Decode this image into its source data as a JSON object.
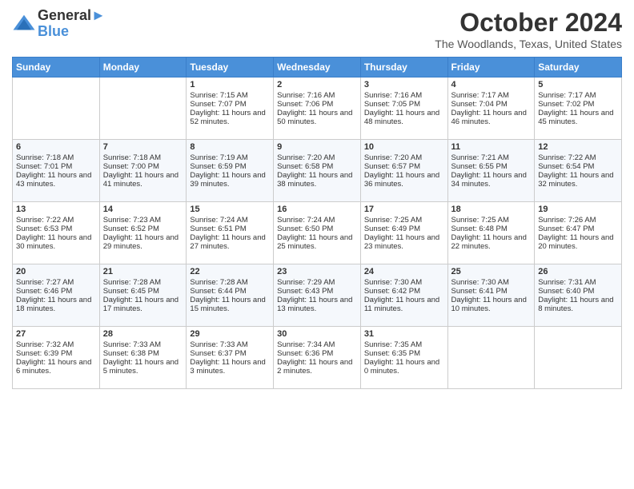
{
  "header": {
    "logo_line1": "General",
    "logo_line2": "Blue",
    "month": "October 2024",
    "location": "The Woodlands, Texas, United States"
  },
  "weekdays": [
    "Sunday",
    "Monday",
    "Tuesday",
    "Wednesday",
    "Thursday",
    "Friday",
    "Saturday"
  ],
  "weeks": [
    [
      {
        "num": "",
        "empty": true
      },
      {
        "num": "",
        "empty": true
      },
      {
        "num": "1",
        "sunrise": "Sunrise: 7:15 AM",
        "sunset": "Sunset: 7:07 PM",
        "daylight": "Daylight: 11 hours and 52 minutes."
      },
      {
        "num": "2",
        "sunrise": "Sunrise: 7:16 AM",
        "sunset": "Sunset: 7:06 PM",
        "daylight": "Daylight: 11 hours and 50 minutes."
      },
      {
        "num": "3",
        "sunrise": "Sunrise: 7:16 AM",
        "sunset": "Sunset: 7:05 PM",
        "daylight": "Daylight: 11 hours and 48 minutes."
      },
      {
        "num": "4",
        "sunrise": "Sunrise: 7:17 AM",
        "sunset": "Sunset: 7:04 PM",
        "daylight": "Daylight: 11 hours and 46 minutes."
      },
      {
        "num": "5",
        "sunrise": "Sunrise: 7:17 AM",
        "sunset": "Sunset: 7:02 PM",
        "daylight": "Daylight: 11 hours and 45 minutes."
      }
    ],
    [
      {
        "num": "6",
        "sunrise": "Sunrise: 7:18 AM",
        "sunset": "Sunset: 7:01 PM",
        "daylight": "Daylight: 11 hours and 43 minutes."
      },
      {
        "num": "7",
        "sunrise": "Sunrise: 7:18 AM",
        "sunset": "Sunset: 7:00 PM",
        "daylight": "Daylight: 11 hours and 41 minutes."
      },
      {
        "num": "8",
        "sunrise": "Sunrise: 7:19 AM",
        "sunset": "Sunset: 6:59 PM",
        "daylight": "Daylight: 11 hours and 39 minutes."
      },
      {
        "num": "9",
        "sunrise": "Sunrise: 7:20 AM",
        "sunset": "Sunset: 6:58 PM",
        "daylight": "Daylight: 11 hours and 38 minutes."
      },
      {
        "num": "10",
        "sunrise": "Sunrise: 7:20 AM",
        "sunset": "Sunset: 6:57 PM",
        "daylight": "Daylight: 11 hours and 36 minutes."
      },
      {
        "num": "11",
        "sunrise": "Sunrise: 7:21 AM",
        "sunset": "Sunset: 6:55 PM",
        "daylight": "Daylight: 11 hours and 34 minutes."
      },
      {
        "num": "12",
        "sunrise": "Sunrise: 7:22 AM",
        "sunset": "Sunset: 6:54 PM",
        "daylight": "Daylight: 11 hours and 32 minutes."
      }
    ],
    [
      {
        "num": "13",
        "sunrise": "Sunrise: 7:22 AM",
        "sunset": "Sunset: 6:53 PM",
        "daylight": "Daylight: 11 hours and 30 minutes."
      },
      {
        "num": "14",
        "sunrise": "Sunrise: 7:23 AM",
        "sunset": "Sunset: 6:52 PM",
        "daylight": "Daylight: 11 hours and 29 minutes."
      },
      {
        "num": "15",
        "sunrise": "Sunrise: 7:24 AM",
        "sunset": "Sunset: 6:51 PM",
        "daylight": "Daylight: 11 hours and 27 minutes."
      },
      {
        "num": "16",
        "sunrise": "Sunrise: 7:24 AM",
        "sunset": "Sunset: 6:50 PM",
        "daylight": "Daylight: 11 hours and 25 minutes."
      },
      {
        "num": "17",
        "sunrise": "Sunrise: 7:25 AM",
        "sunset": "Sunset: 6:49 PM",
        "daylight": "Daylight: 11 hours and 23 minutes."
      },
      {
        "num": "18",
        "sunrise": "Sunrise: 7:25 AM",
        "sunset": "Sunset: 6:48 PM",
        "daylight": "Daylight: 11 hours and 22 minutes."
      },
      {
        "num": "19",
        "sunrise": "Sunrise: 7:26 AM",
        "sunset": "Sunset: 6:47 PM",
        "daylight": "Daylight: 11 hours and 20 minutes."
      }
    ],
    [
      {
        "num": "20",
        "sunrise": "Sunrise: 7:27 AM",
        "sunset": "Sunset: 6:46 PM",
        "daylight": "Daylight: 11 hours and 18 minutes."
      },
      {
        "num": "21",
        "sunrise": "Sunrise: 7:28 AM",
        "sunset": "Sunset: 6:45 PM",
        "daylight": "Daylight: 11 hours and 17 minutes."
      },
      {
        "num": "22",
        "sunrise": "Sunrise: 7:28 AM",
        "sunset": "Sunset: 6:44 PM",
        "daylight": "Daylight: 11 hours and 15 minutes."
      },
      {
        "num": "23",
        "sunrise": "Sunrise: 7:29 AM",
        "sunset": "Sunset: 6:43 PM",
        "daylight": "Daylight: 11 hours and 13 minutes."
      },
      {
        "num": "24",
        "sunrise": "Sunrise: 7:30 AM",
        "sunset": "Sunset: 6:42 PM",
        "daylight": "Daylight: 11 hours and 11 minutes."
      },
      {
        "num": "25",
        "sunrise": "Sunrise: 7:30 AM",
        "sunset": "Sunset: 6:41 PM",
        "daylight": "Daylight: 11 hours and 10 minutes."
      },
      {
        "num": "26",
        "sunrise": "Sunrise: 7:31 AM",
        "sunset": "Sunset: 6:40 PM",
        "daylight": "Daylight: 11 hours and 8 minutes."
      }
    ],
    [
      {
        "num": "27",
        "sunrise": "Sunrise: 7:32 AM",
        "sunset": "Sunset: 6:39 PM",
        "daylight": "Daylight: 11 hours and 6 minutes."
      },
      {
        "num": "28",
        "sunrise": "Sunrise: 7:33 AM",
        "sunset": "Sunset: 6:38 PM",
        "daylight": "Daylight: 11 hours and 5 minutes."
      },
      {
        "num": "29",
        "sunrise": "Sunrise: 7:33 AM",
        "sunset": "Sunset: 6:37 PM",
        "daylight": "Daylight: 11 hours and 3 minutes."
      },
      {
        "num": "30",
        "sunrise": "Sunrise: 7:34 AM",
        "sunset": "Sunset: 6:36 PM",
        "daylight": "Daylight: 11 hours and 2 minutes."
      },
      {
        "num": "31",
        "sunrise": "Sunrise: 7:35 AM",
        "sunset": "Sunset: 6:35 PM",
        "daylight": "Daylight: 11 hours and 0 minutes."
      },
      {
        "num": "",
        "empty": true
      },
      {
        "num": "",
        "empty": true
      }
    ]
  ]
}
